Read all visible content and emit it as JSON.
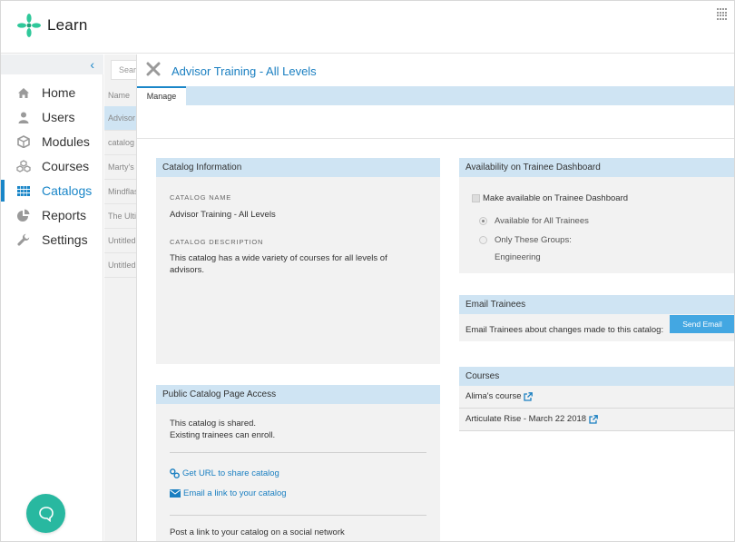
{
  "app": {
    "name": "Learn"
  },
  "nav": {
    "items": [
      {
        "label": "Home",
        "icon": "home-icon"
      },
      {
        "label": "Users",
        "icon": "user-icon"
      },
      {
        "label": "Modules",
        "icon": "cube-icon"
      },
      {
        "label": "Courses",
        "icon": "cubes-icon"
      },
      {
        "label": "Catalogs",
        "icon": "grid-icon",
        "active": true
      },
      {
        "label": "Reports",
        "icon": "pie-chart-icon"
      },
      {
        "label": "Settings",
        "icon": "wrench-icon"
      }
    ]
  },
  "list": {
    "search_placeholder": "Sear",
    "header": "Name",
    "rows": [
      "Advisor",
      "catalog",
      "Marty's",
      "Mindflas",
      "The Ulti",
      "Untitled",
      "Untitled"
    ]
  },
  "panel": {
    "title": "Advisor Training - All Levels",
    "tabs": [
      "Manage"
    ]
  },
  "catalog_info": {
    "header": "Catalog Information",
    "name_caption": "Catalog Name",
    "name_value": "Advisor Training - All Levels",
    "desc_caption": "Catalog Description",
    "desc_value": "This catalog has a wide variety of courses for all levels of advisors."
  },
  "public_access": {
    "header": "Public Catalog Page Access",
    "line1": "This catalog is shared.",
    "line2": "Existing trainees can enroll.",
    "get_url": "Get URL to share catalog",
    "email_link": "Email a link to your catalog",
    "social": "Post a link to your catalog on a social network"
  },
  "availability": {
    "header": "Availability on Trainee Dashboard",
    "make_available": "Make available on Trainee Dashboard",
    "all_trainees": "Available for All Trainees",
    "only_groups": "Only These Groups:",
    "group": "Engineering"
  },
  "email_trainees": {
    "header": "Email Trainees",
    "text": "Email Trainees about changes made to this catalog:",
    "button": "Send Email"
  },
  "courses": {
    "header": "Courses",
    "items": [
      "Alima's course",
      "Articulate Rise - March 22 2018"
    ]
  },
  "colors": {
    "accent": "#1a86c8",
    "header_bg": "#cfe4f3",
    "card_bg": "#f2f2f2",
    "chat": "#28b8a0",
    "button": "#43a7e2"
  }
}
